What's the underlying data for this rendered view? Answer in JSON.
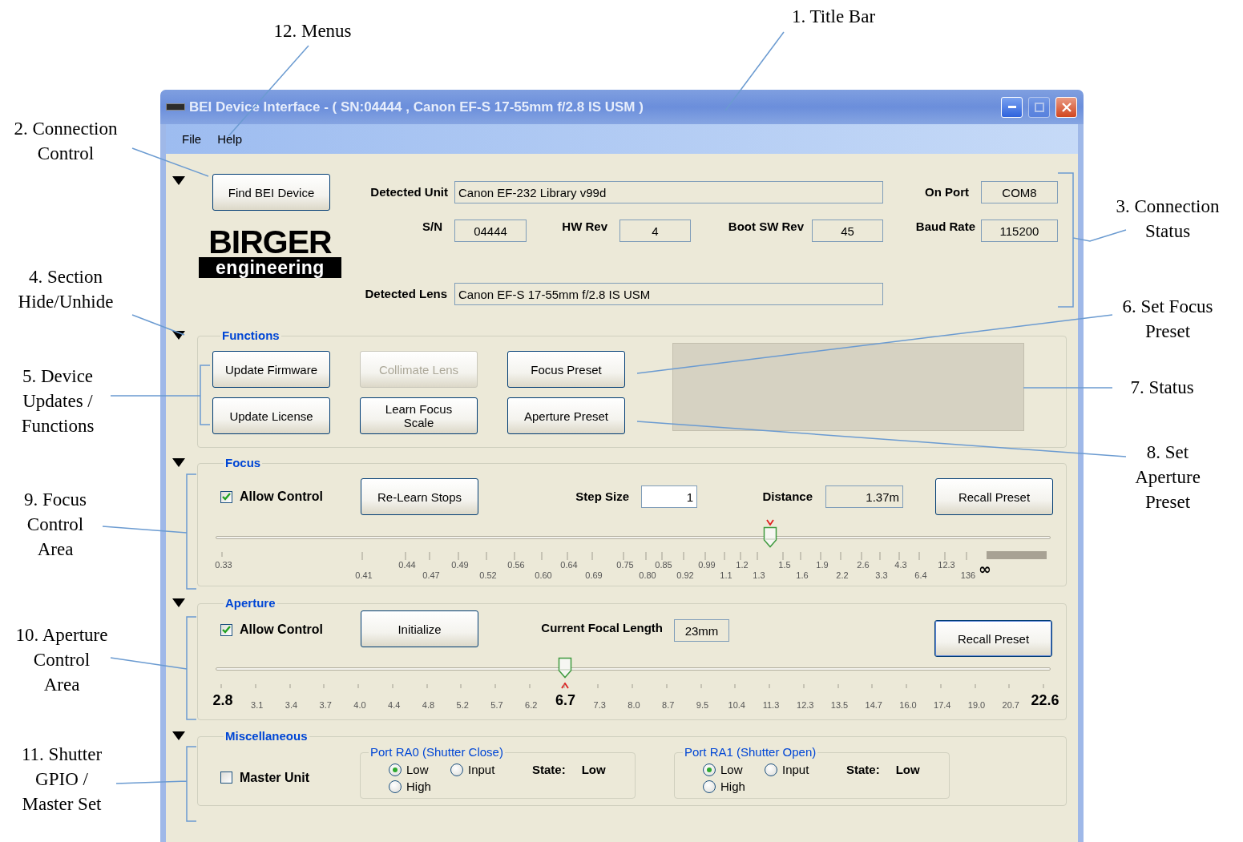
{
  "callouts": [
    {
      "lines": [
        "1. Title Bar"
      ]
    },
    {
      "lines": [
        "2. Connection",
        "Control"
      ]
    },
    {
      "lines": [
        "3. Connection",
        "Status"
      ]
    },
    {
      "lines": [
        "4. Section",
        "Hide/Unhide"
      ]
    },
    {
      "lines": [
        "5. Device",
        "Updates /",
        "Functions"
      ]
    },
    {
      "lines": [
        "6. Set Focus",
        "Preset"
      ]
    },
    {
      "lines": [
        "7. Status"
      ]
    },
    {
      "lines": [
        "8. Set",
        "Aperture",
        "Preset"
      ]
    },
    {
      "lines": [
        "9. Focus",
        "Control",
        "Area"
      ]
    },
    {
      "lines": [
        "10. Aperture",
        "Control",
        "Area"
      ]
    },
    {
      "lines": [
        "11. Shutter",
        "GPIO /",
        "Master Set"
      ]
    },
    {
      "lines": [
        "12. Menus"
      ]
    }
  ],
  "window": {
    "title": "BEI Device Interface - ( SN:04444 , Canon EF-S 17-55mm f/2.8 IS USM )",
    "menus": [
      "File",
      "Help"
    ],
    "connection": {
      "expanded": true,
      "find_button": "Find BEI Device",
      "logo": {
        "wordmark": "BIRGER",
        "tagline": "engineering"
      },
      "fields": [
        {
          "label": "Detected Unit",
          "value": "Canon EF-232 Library v99d"
        },
        {
          "label": "On Port",
          "value": "COM8"
        },
        {
          "label": "S/N",
          "value": "04444"
        },
        {
          "label": "HW Rev",
          "value": "4"
        },
        {
          "label": "Boot SW Rev",
          "value": "45"
        },
        {
          "label": "Baud Rate",
          "value": "115200"
        },
        {
          "label": "Detected Lens",
          "value": "Canon EF-S 17-55mm f/2.8 IS USM"
        }
      ]
    },
    "functions": {
      "title": "Functions",
      "expanded": true,
      "buttons": [
        {
          "label": "Update Firmware",
          "disabled": false
        },
        {
          "label": "Update License",
          "disabled": false
        },
        {
          "label": "Collimate Lens",
          "disabled": true
        },
        {
          "label": "Learn Focus Scale",
          "disabled": false
        },
        {
          "label": "Focus Preset",
          "disabled": false
        },
        {
          "label": "Aperture Preset",
          "disabled": false
        }
      ]
    },
    "focus": {
      "title": "Focus",
      "expanded": true,
      "allow_control": {
        "label": "Allow Control",
        "checked": true
      },
      "relearn_button": "Re-Learn Stops",
      "step_size": {
        "label": "Step Size",
        "value": "1"
      },
      "distance": {
        "label": "Distance",
        "value": "1.37m"
      },
      "recall_button": "Recall Preset",
      "slider": {
        "level": 0.664
      },
      "scale": [
        "0.33",
        "0.41",
        "0.44",
        "0.47",
        "0.49",
        "0.52",
        "0.56",
        "0.60",
        "0.64",
        "0.69",
        "0.75",
        "0.80",
        "0.85",
        "0.92",
        "0.99",
        "1.1",
        "1.2",
        "1.3",
        "1.5",
        "1.6",
        "1.9",
        "2.2",
        "2.6",
        "3.3",
        "4.3",
        "6.4",
        "12.3",
        "136"
      ],
      "infinity_label": "∞"
    },
    "aperture": {
      "title": "Aperture",
      "expanded": true,
      "allow_control": {
        "label": "Allow Control",
        "checked": true
      },
      "initialize_button": "Initialize",
      "focal_length": {
        "label": "Current Focal Length",
        "value": "23mm"
      },
      "recall_button": "Recall Preset",
      "slider": {
        "level": 0.418
      },
      "scale": [
        {
          "text": "2.8",
          "emphasized": true
        },
        {
          "text": "3.1",
          "emphasized": false
        },
        {
          "text": "3.4",
          "emphasized": false
        },
        {
          "text": "3.7",
          "emphasized": false
        },
        {
          "text": "4.0",
          "emphasized": false
        },
        {
          "text": "4.4",
          "emphasized": false
        },
        {
          "text": "4.8",
          "emphasized": false
        },
        {
          "text": "5.2",
          "emphasized": false
        },
        {
          "text": "5.7",
          "emphasized": false
        },
        {
          "text": "6.2",
          "emphasized": false
        },
        {
          "text": "6.7",
          "emphasized": true
        },
        {
          "text": "7.3",
          "emphasized": false
        },
        {
          "text": "8.0",
          "emphasized": false
        },
        {
          "text": "8.7",
          "emphasized": false
        },
        {
          "text": "9.5",
          "emphasized": false
        },
        {
          "text": "10.4",
          "emphasized": false
        },
        {
          "text": "11.3",
          "emphasized": false
        },
        {
          "text": "12.3",
          "emphasized": false
        },
        {
          "text": "13.5",
          "emphasized": false
        },
        {
          "text": "14.7",
          "emphasized": false
        },
        {
          "text": "16.0",
          "emphasized": false
        },
        {
          "text": "17.4",
          "emphasized": false
        },
        {
          "text": "19.0",
          "emphasized": false
        },
        {
          "text": "20.7",
          "emphasized": false
        },
        {
          "text": "22.6",
          "emphasized": true
        }
      ]
    },
    "misc": {
      "title": "Miscellaneous",
      "expanded": true,
      "master_unit": {
        "label": "Master Unit",
        "checked": false
      },
      "ports": [
        {
          "title": "Port RA0 (Shutter Close)",
          "options": [
            {
              "label": "Low",
              "selected": true
            },
            {
              "label": "Input",
              "selected": false
            },
            {
              "label": "High",
              "selected": false
            }
          ],
          "state_label": "State:",
          "state_value": "Low"
        },
        {
          "title": "Port RA1 (Shutter Open)",
          "options": [
            {
              "label": "Low",
              "selected": true
            },
            {
              "label": "Input",
              "selected": false
            },
            {
              "label": "High",
              "selected": false
            }
          ],
          "state_label": "State:",
          "state_value": "Low"
        }
      ]
    }
  }
}
